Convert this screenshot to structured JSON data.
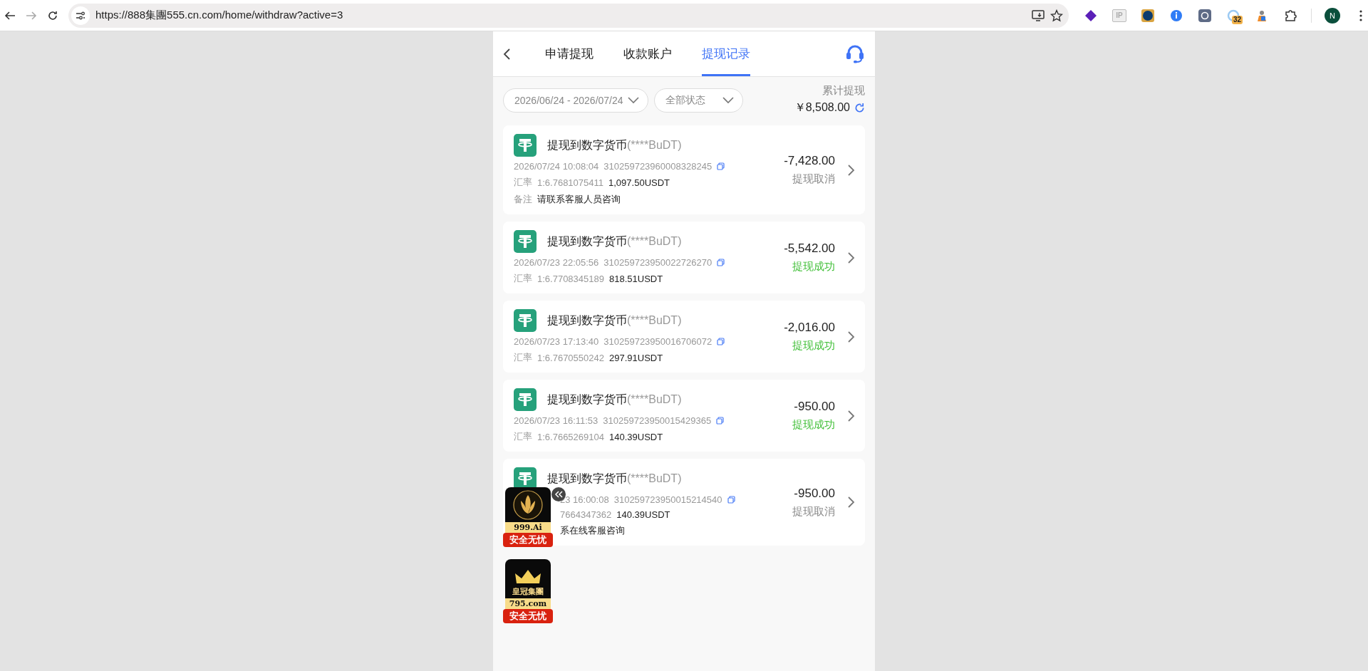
{
  "browser": {
    "url": "https://888集團555.cn.com/home/withdraw?active=3",
    "ip_extension_label": "IP",
    "extension_badge": "32",
    "profile_initial": "N"
  },
  "tabs": [
    {
      "label": "申请提现",
      "selected": false
    },
    {
      "label": "收款账户",
      "selected": false
    },
    {
      "label": "提现记录",
      "selected": true
    }
  ],
  "filters": {
    "date_range": "2026/06/24 - 2026/07/24",
    "status": "全部状态"
  },
  "summary": {
    "label": "累计提现",
    "total": "￥8,508.00"
  },
  "records": [
    {
      "title": "提现到数字货币",
      "account": "(****BuDT)",
      "datetime": "2026/07/24 10:08:04",
      "order_no": "310259723960008328245",
      "rate_label": "汇率",
      "rate": "1:6.7681075411",
      "usdt": "1,097.50USDT",
      "remark_label": "备注",
      "remark": "请联系客服人员咨询",
      "amount": "-7,428.00",
      "status": "提现取消",
      "color": "#888888",
      "covered": false
    },
    {
      "title": "提现到数字货币",
      "account": "(****BuDT)",
      "datetime": "2026/07/23 22:05:56",
      "order_no": "310259723950022726270",
      "rate_label": "汇率",
      "rate": "1:6.7708345189",
      "usdt": "818.51USDT",
      "amount": "-5,542.00",
      "status": "提现成功",
      "color": "#3fbf36",
      "covered": false
    },
    {
      "title": "提现到数字货币",
      "account": "(****BuDT)",
      "datetime": "2026/07/23 17:13:40",
      "order_no": "310259723950016706072",
      "rate_label": "汇率",
      "rate": "1:6.7670550242",
      "usdt": "297.91USDT",
      "amount": "-2,016.00",
      "status": "提现成功",
      "color": "#3fbf36",
      "covered": false
    },
    {
      "title": "提现到数字货币",
      "account": "(****BuDT)",
      "datetime": "2026/07/23 16:11:53",
      "order_no": "310259723950015429365",
      "rate_label": "汇率",
      "rate": "1:6.7665269104",
      "usdt": "140.39USDT",
      "amount": "-950.00",
      "status": "提现成功",
      "color": "#3fbf36",
      "covered": false
    },
    {
      "title": "提现到数字货币",
      "account": "(****BuDT)",
      "datetime": "23 16:00:08",
      "order_no": "310259723950015214540",
      "rate": "7664347362",
      "usdt": "140.39USDT",
      "remark": "系在线客服咨询",
      "amount": "-950.00",
      "status": "提现取消",
      "color": "#888888",
      "covered": true
    }
  ],
  "floating_ads": [
    {
      "kind": "lotus",
      "caption": "999.Ai",
      "badge": "安全无忧"
    },
    {
      "kind": "crown",
      "name": "皇冠集團",
      "caption": "795.com",
      "badge": "安全无忧"
    }
  ]
}
